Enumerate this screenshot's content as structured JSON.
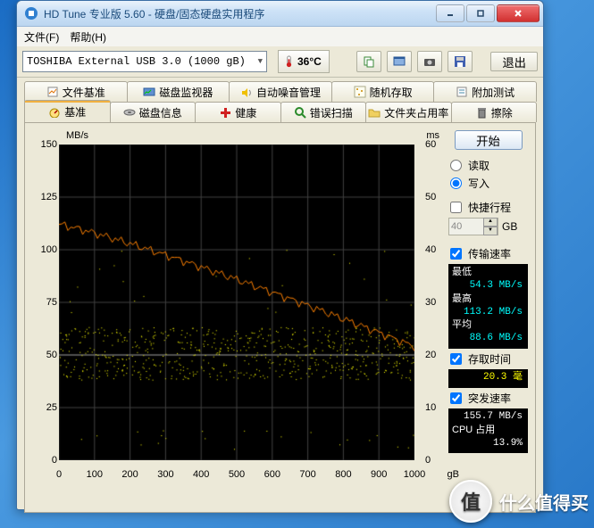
{
  "window_title": "HD Tune 专业版 5.60 - 硬盘/固态硬盘实用程序",
  "menu": {
    "file": "文件(F)",
    "help": "帮助(H)"
  },
  "toolbar": {
    "drive": "TOSHIBA External USB 3.0 (1000 gB)",
    "temp": "36°C",
    "exit": "退出"
  },
  "tabs_top": [
    {
      "icon": "file-bench",
      "label": "文件基准"
    },
    {
      "icon": "disk-monitor",
      "label": "磁盘监视器"
    },
    {
      "icon": "aam",
      "label": "自动噪音管理"
    },
    {
      "icon": "random",
      "label": "随机存取"
    },
    {
      "icon": "extra",
      "label": "附加测试"
    }
  ],
  "tabs_bottom": [
    {
      "icon": "bench",
      "label": "基准",
      "active": true
    },
    {
      "icon": "info",
      "label": "磁盘信息"
    },
    {
      "icon": "health",
      "label": "健康"
    },
    {
      "icon": "errscan",
      "label": "错误扫描"
    },
    {
      "icon": "folder",
      "label": "文件夹占用率"
    },
    {
      "icon": "erase",
      "label": "擦除"
    }
  ],
  "side": {
    "start": "开始",
    "read": "读取",
    "write": "写入",
    "shortcut": "快捷行程",
    "gb_value": "40",
    "gb_unit": "GB",
    "transfer_rate": "传输速率",
    "min_label": "最低",
    "min_value": "54.3 MB/s",
    "max_label": "最高",
    "max_value": "113.2 MB/s",
    "avg_label": "平均",
    "avg_value": "88.6 MB/s",
    "access_time": "存取时间",
    "access_value": "20.3 毫",
    "burst_rate": "突发速率",
    "burst_value": "155.7 MB/s",
    "cpu_label": "CPU 占用",
    "cpu_value": "13.9%"
  },
  "watermark": {
    "char": "值",
    "text": "什么值得买"
  },
  "chart_data": {
    "type": "line+scatter",
    "title": "",
    "x_unit": "gB",
    "y_left_unit": "MB/s",
    "y_right_unit": "ms",
    "xlim": [
      0,
      1000
    ],
    "ylim_left": [
      0,
      150
    ],
    "ylim_right": [
      0,
      60
    ],
    "x_ticks": [
      0,
      100,
      200,
      300,
      400,
      500,
      600,
      700,
      800,
      900,
      1000
    ],
    "y_left_ticks": [
      0,
      25,
      50,
      75,
      100,
      125,
      150
    ],
    "y_right_ticks": [
      0,
      10,
      20,
      30,
      40,
      50,
      60
    ],
    "series": [
      {
        "name": "transfer",
        "axis": "left",
        "color": "#ff8000",
        "style": "line",
        "segments": 120,
        "start": 112,
        "end": 54,
        "noise": 3
      },
      {
        "name": "access",
        "axis": "right",
        "color": "#ffff00",
        "style": "scatter",
        "count": 700,
        "mean": 20.3,
        "spread": 5,
        "outlier_low": 2,
        "outlier_high": 40
      }
    ]
  }
}
